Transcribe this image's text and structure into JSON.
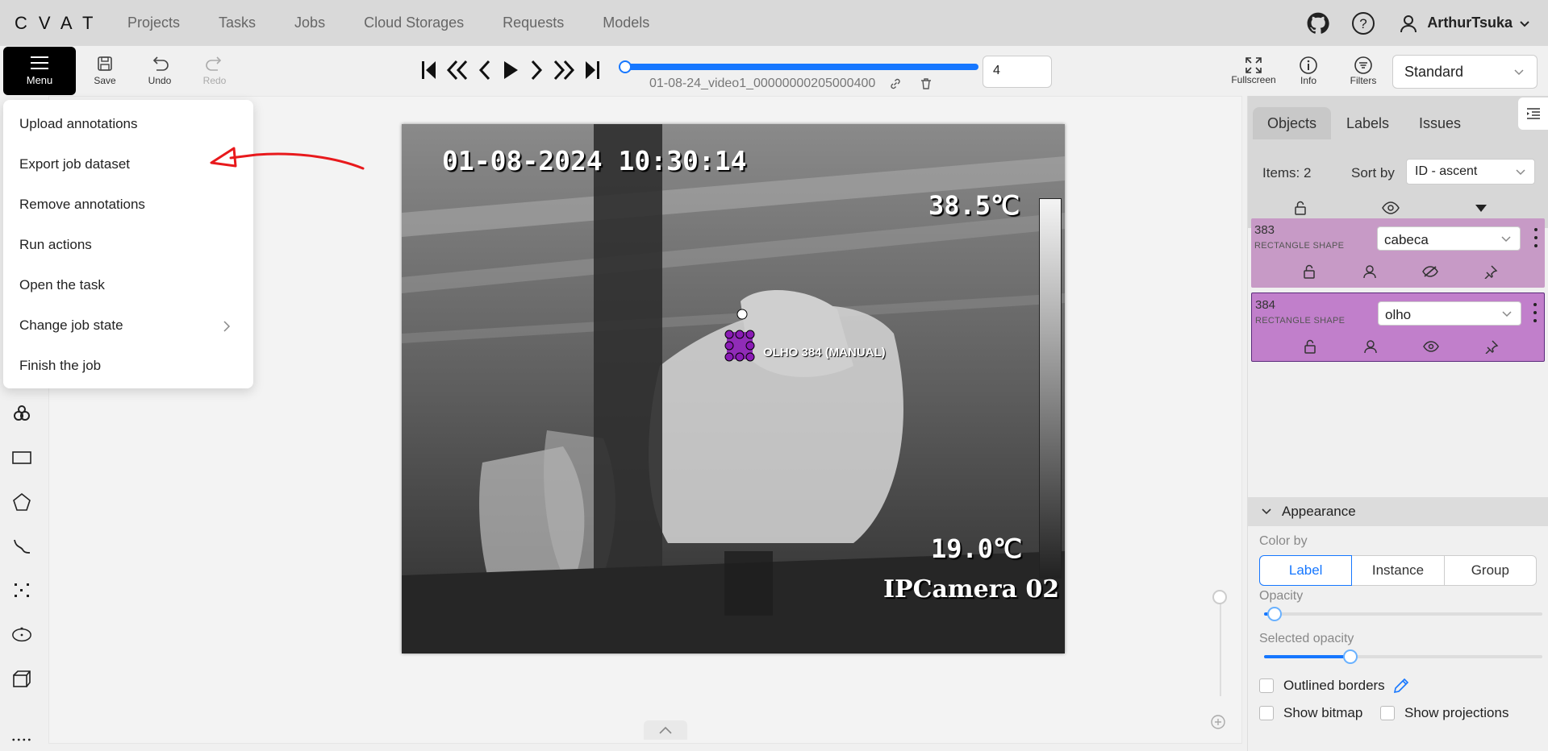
{
  "app": {
    "logo": "CVAT",
    "nav": [
      "Projects",
      "Tasks",
      "Jobs",
      "Cloud Storages",
      "Requests",
      "Models"
    ],
    "user": "ArthurTsuka"
  },
  "toolbar": {
    "menu_label": "Menu",
    "save_label": "Save",
    "undo_label": "Undo",
    "redo_label": "Redo",
    "filename": "01-08-24_video1_00000000205000400",
    "frame_number": "4",
    "fullscreen_label": "Fullscreen",
    "info_label": "Info",
    "filters_label": "Filters",
    "workspace": "Standard"
  },
  "menu": {
    "items": [
      "Upload annotations",
      "Export job dataset",
      "Remove annotations",
      "Run actions",
      "Open the task",
      "Change job state",
      "Finish the job"
    ]
  },
  "canvas": {
    "timestamp": "01-08-2024 10:30:14",
    "temp_high": "38.5℃",
    "temp_low": "19.0℃",
    "camera_name": "IPCamera 02",
    "shape_label": "OLHO 384 (MANUAL)"
  },
  "sidebar": {
    "tabs": [
      "Objects",
      "Labels",
      "Issues"
    ],
    "items_count": "Items: 2",
    "sort_by_label": "Sort by",
    "sort_value": "ID - ascent",
    "objects": [
      {
        "id": "383",
        "type": "RECTANGLE SHAPE",
        "label": "cabeca",
        "color": "#c79ac6"
      },
      {
        "id": "384",
        "type": "RECTANGLE SHAPE",
        "label": "olho",
        "color": "#c17fcb"
      }
    ],
    "appearance": {
      "title": "Appearance",
      "color_by_label": "Color by",
      "color_by_options": [
        "Label",
        "Instance",
        "Group"
      ],
      "color_by_selected": "Label",
      "opacity_label": "Opacity",
      "opacity_value": 0.03,
      "selected_opacity_label": "Selected opacity",
      "selected_opacity_value": 0.3,
      "outlined_borders_label": "Outlined borders",
      "show_bitmap_label": "Show bitmap",
      "show_projections_label": "Show projections"
    }
  },
  "colors": {
    "accent": "#1677ff",
    "annotation": "#8a1bb5",
    "red_arrow": "#e8191c"
  }
}
